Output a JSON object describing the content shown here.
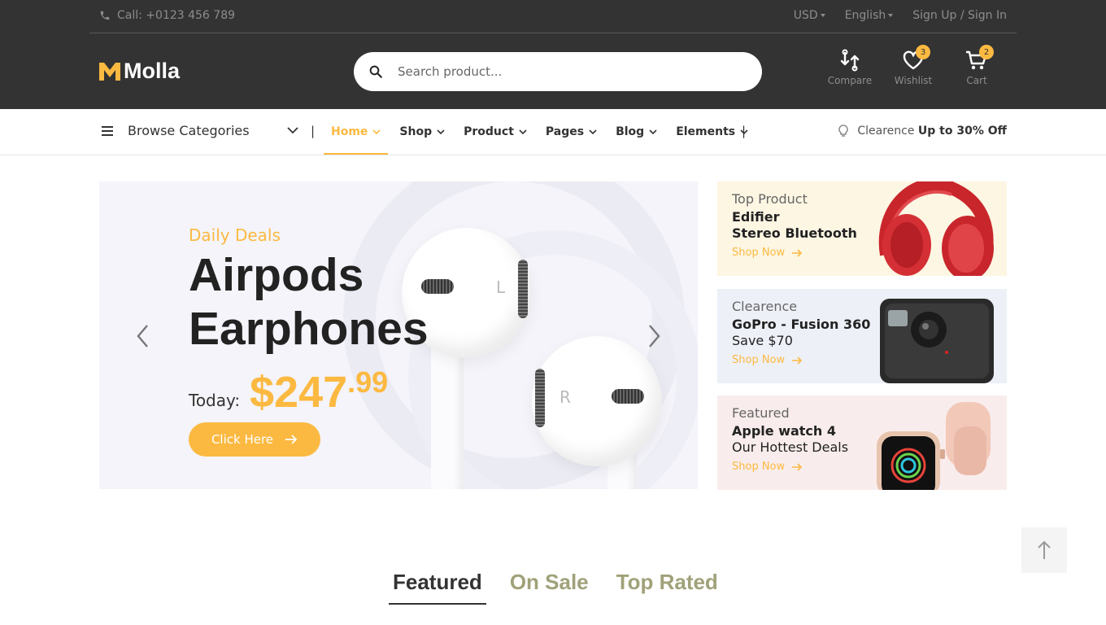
{
  "topbar": {
    "phone": "Call: +0123 456 789",
    "currency": "USD",
    "language": "English",
    "signup": "Sign Up",
    "slash": "/",
    "signin": "Sign In"
  },
  "logo": {
    "text": "Molla"
  },
  "search": {
    "placeholder": "Search product..."
  },
  "header_icons": {
    "compare": {
      "label": "Compare",
      "icon": "compare-icon"
    },
    "wishlist": {
      "label": "Wishlist",
      "count": "3",
      "icon": "heart-icon"
    },
    "cart": {
      "label": "Cart",
      "count": "2",
      "icon": "cart-icon"
    }
  },
  "nav": {
    "browse": "Browse Categories",
    "sep": "|",
    "items": [
      {
        "label": "Home"
      },
      {
        "label": "Shop"
      },
      {
        "label": "Product"
      },
      {
        "label": "Pages"
      },
      {
        "label": "Blog"
      },
      {
        "label": "Elements"
      }
    ],
    "clearence_label": "Clearence",
    "clearence_offer": "Up to 30% Off"
  },
  "hero": {
    "kicker": "Daily Deals",
    "title": "Airpods Earphones",
    "today": "Today:",
    "price_main": "$247",
    "price_cents": ".99",
    "button": "Click Here",
    "bud_left_letter": "L",
    "bud_right_letter": "R"
  },
  "side_banners": [
    {
      "subtitle": "Top Product",
      "title": "Edifier",
      "line2": "Stereo Bluetooth",
      "link": "Shop Now",
      "bg": "#fdf6e3"
    },
    {
      "subtitle": "Clearence",
      "title": "GoPro - Fusion 360",
      "line2": "Save $70",
      "link": "Shop Now",
      "bg": "#eef0f8"
    },
    {
      "subtitle": "Featured",
      "title": "Apple watch 4",
      "line2": "Our Hottest Deals",
      "link": "Shop Now",
      "bg": "#f9ecec"
    }
  ],
  "tabs": [
    {
      "label": "Featured"
    },
    {
      "label": "On Sale"
    },
    {
      "label": "Top Rated"
    }
  ],
  "colors": {
    "accent": "#fcb941",
    "dark": "#333333"
  }
}
